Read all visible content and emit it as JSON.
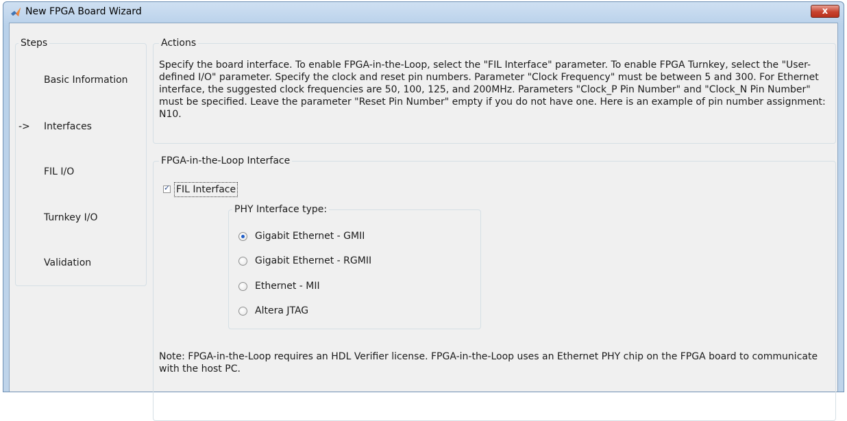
{
  "window": {
    "title": "New FPGA Board Wizard",
    "close_label": "x"
  },
  "steps": {
    "heading": "Steps",
    "items": [
      {
        "label": "Basic Information",
        "prefix": ""
      },
      {
        "label": "Interfaces",
        "prefix": "->"
      },
      {
        "label": "FIL I/O",
        "prefix": ""
      },
      {
        "label": "Turnkey I/O",
        "prefix": ""
      },
      {
        "label": "Validation",
        "prefix": ""
      }
    ]
  },
  "actions": {
    "heading": "Actions",
    "text": "Specify the board interface. To enable FPGA-in-the-Loop, select the \"FIL Interface\" parameter. To enable FPGA Turnkey, select the \"User-defined I/O\" parameter. Specify the clock and reset pin numbers. Parameter \"Clock Frequency\" must be between 5 and 300. For Ethernet interface, the suggested clock frequencies are 50, 100, 125, and 200MHz. Parameters \"Clock_P Pin Number\" and \"Clock_N Pin Number\" must be specified. Leave the parameter \"Reset Pin Number\" empty if you do not have one. Here is an example of pin number assignment: N10."
  },
  "fil": {
    "heading": "FPGA-in-the-Loop Interface",
    "checkbox_label": "FIL Interface",
    "checkbox_checked": true,
    "check_glyph": "✓",
    "phy": {
      "heading": "PHY Interface type:",
      "options": [
        {
          "label": "Gigabit Ethernet - GMII",
          "selected": true
        },
        {
          "label": "Gigabit Ethernet - RGMII",
          "selected": false
        },
        {
          "label": "Ethernet - MII",
          "selected": false
        },
        {
          "label": "Altera JTAG",
          "selected": false
        }
      ]
    },
    "note": "Note: FPGA-in-the-Loop requires an HDL Verifier license. FPGA-in-the-Loop uses an Ethernet PHY chip on the FPGA board to communicate with the host PC."
  },
  "icons": {
    "app": "matlab-icon",
    "close": "close-icon"
  }
}
